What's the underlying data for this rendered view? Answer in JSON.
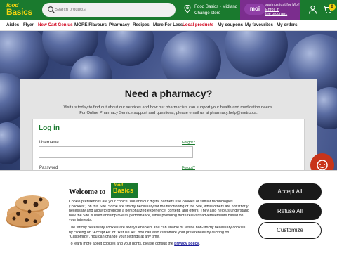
{
  "header": {
    "logo_line1": "food",
    "logo_line2": "Basics",
    "search_placeholder": "Search products",
    "store_name": "Food Basics - Midland",
    "store_change": "Change store",
    "moi_badge": "moi",
    "moi_line1": "savings just for Moi!",
    "moi_line2": "Enroll in",
    "moi_line3": "the program.",
    "cart_count": "0"
  },
  "nav": {
    "items": [
      {
        "label": "Aisles",
        "accent": false
      },
      {
        "label": "Flyer",
        "accent": false
      },
      {
        "label": "New Cart Genius",
        "accent": true
      },
      {
        "label": "MORE Flavours",
        "accent": false
      },
      {
        "label": "Pharmacy",
        "accent": false
      },
      {
        "label": "Recipes",
        "accent": false
      },
      {
        "label": "More For Less",
        "accent": false
      },
      {
        "label": "Local products",
        "accent": true
      },
      {
        "label": "My coupons",
        "accent": false
      },
      {
        "label": "My favourites",
        "accent": false
      },
      {
        "label": "My orders",
        "accent": false
      }
    ]
  },
  "pharmacy": {
    "title": "Need a pharmacy?",
    "desc1": "Visit us today to find out about our services and how our pharmacists can support your health and medication needs.",
    "desc2": "For Online Pharmacy Service support and questions, please email us at pharmacy.help@metro.ca.",
    "login_title": "Log in",
    "username_label": "Username",
    "username_link": "Forgot?",
    "password_label": "Password",
    "password_link": "Forgot?"
  },
  "cookie": {
    "title": "Welcome to",
    "logo_line1": "food",
    "logo_line2": "Basics",
    "para1": "Cookie preferences are your choice! We and our digital partners use cookies or similar technologies (\"cookies\") on this Site. Some are strictly necessary for the functioning of the Site, while others are not strictly necessary and allow to propose a personalized experience, content, and offers. They also help us understand how the Site is used and improve its performance, while providing more relevant advertisements based on your interests.",
    "para2": "The strictly necessary cookies are always enabled. You can enable or refuse non-strictly necessary cookies by clicking on \"Accept All\" or \"Refuse All\". You can also customize your preferences by clicking on \"Customize\". You can change your settings at any time.",
    "para3_prefix": "To learn more about cookies and your rights, please consult the ",
    "para3_link": "privacy policy",
    "para3_suffix": ".",
    "accept_label": "Accept All",
    "refuse_label": "Refuse All",
    "customize_label": "Customize"
  },
  "colors": {
    "brand_green": "#1a7a2e",
    "brand_yellow": "#f5d40f",
    "moi_purple": "#7b2d8e",
    "accent_red": "#d0021b",
    "chat_red": "#c8341a"
  },
  "icons": {
    "search": "search-icon",
    "store": "location-pin-icon",
    "account": "user-icon",
    "cart": "cart-icon",
    "chat": "chat-icon"
  }
}
